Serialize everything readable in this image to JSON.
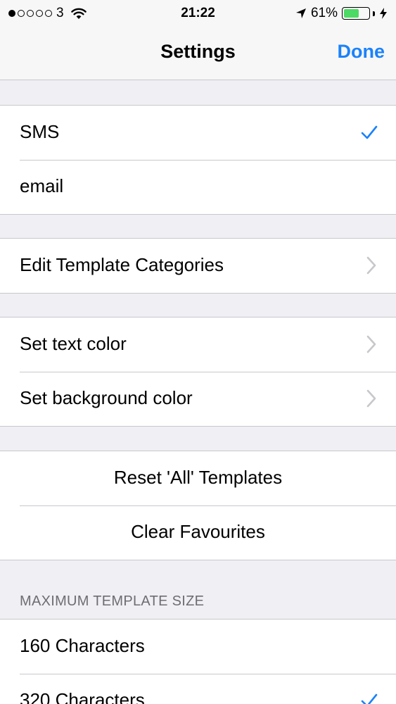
{
  "status_bar": {
    "carrier": "3",
    "time": "21:22",
    "battery_percent": "61%",
    "battery_level": 0.61,
    "signal_strength": 1,
    "signal_max": 5,
    "icons": [
      "wifi-icon",
      "location-arrow-icon",
      "battery-icon",
      "charging-bolt-icon"
    ]
  },
  "nav": {
    "title": "Settings",
    "done_label": "Done"
  },
  "message_type": {
    "items": [
      {
        "label": "SMS",
        "checked": true
      },
      {
        "label": "email",
        "checked": false
      }
    ]
  },
  "templates": {
    "edit_categories_label": "Edit Template Categories"
  },
  "colors": {
    "text_color_label": "Set text color",
    "background_color_label": "Set background color"
  },
  "actions": {
    "reset_label": "Reset 'All' Templates",
    "clear_label": "Clear Favourites"
  },
  "max_size": {
    "header": "MAXIMUM TEMPLATE SIZE",
    "options": [
      {
        "label": "160 Characters",
        "checked": false
      },
      {
        "label": "320 Characters",
        "checked": true
      }
    ]
  },
  "theme": {
    "accent": "#1a82fb",
    "background": "#efeff4",
    "separator": "#c8c7cc",
    "battery_green": "#4cd964"
  }
}
